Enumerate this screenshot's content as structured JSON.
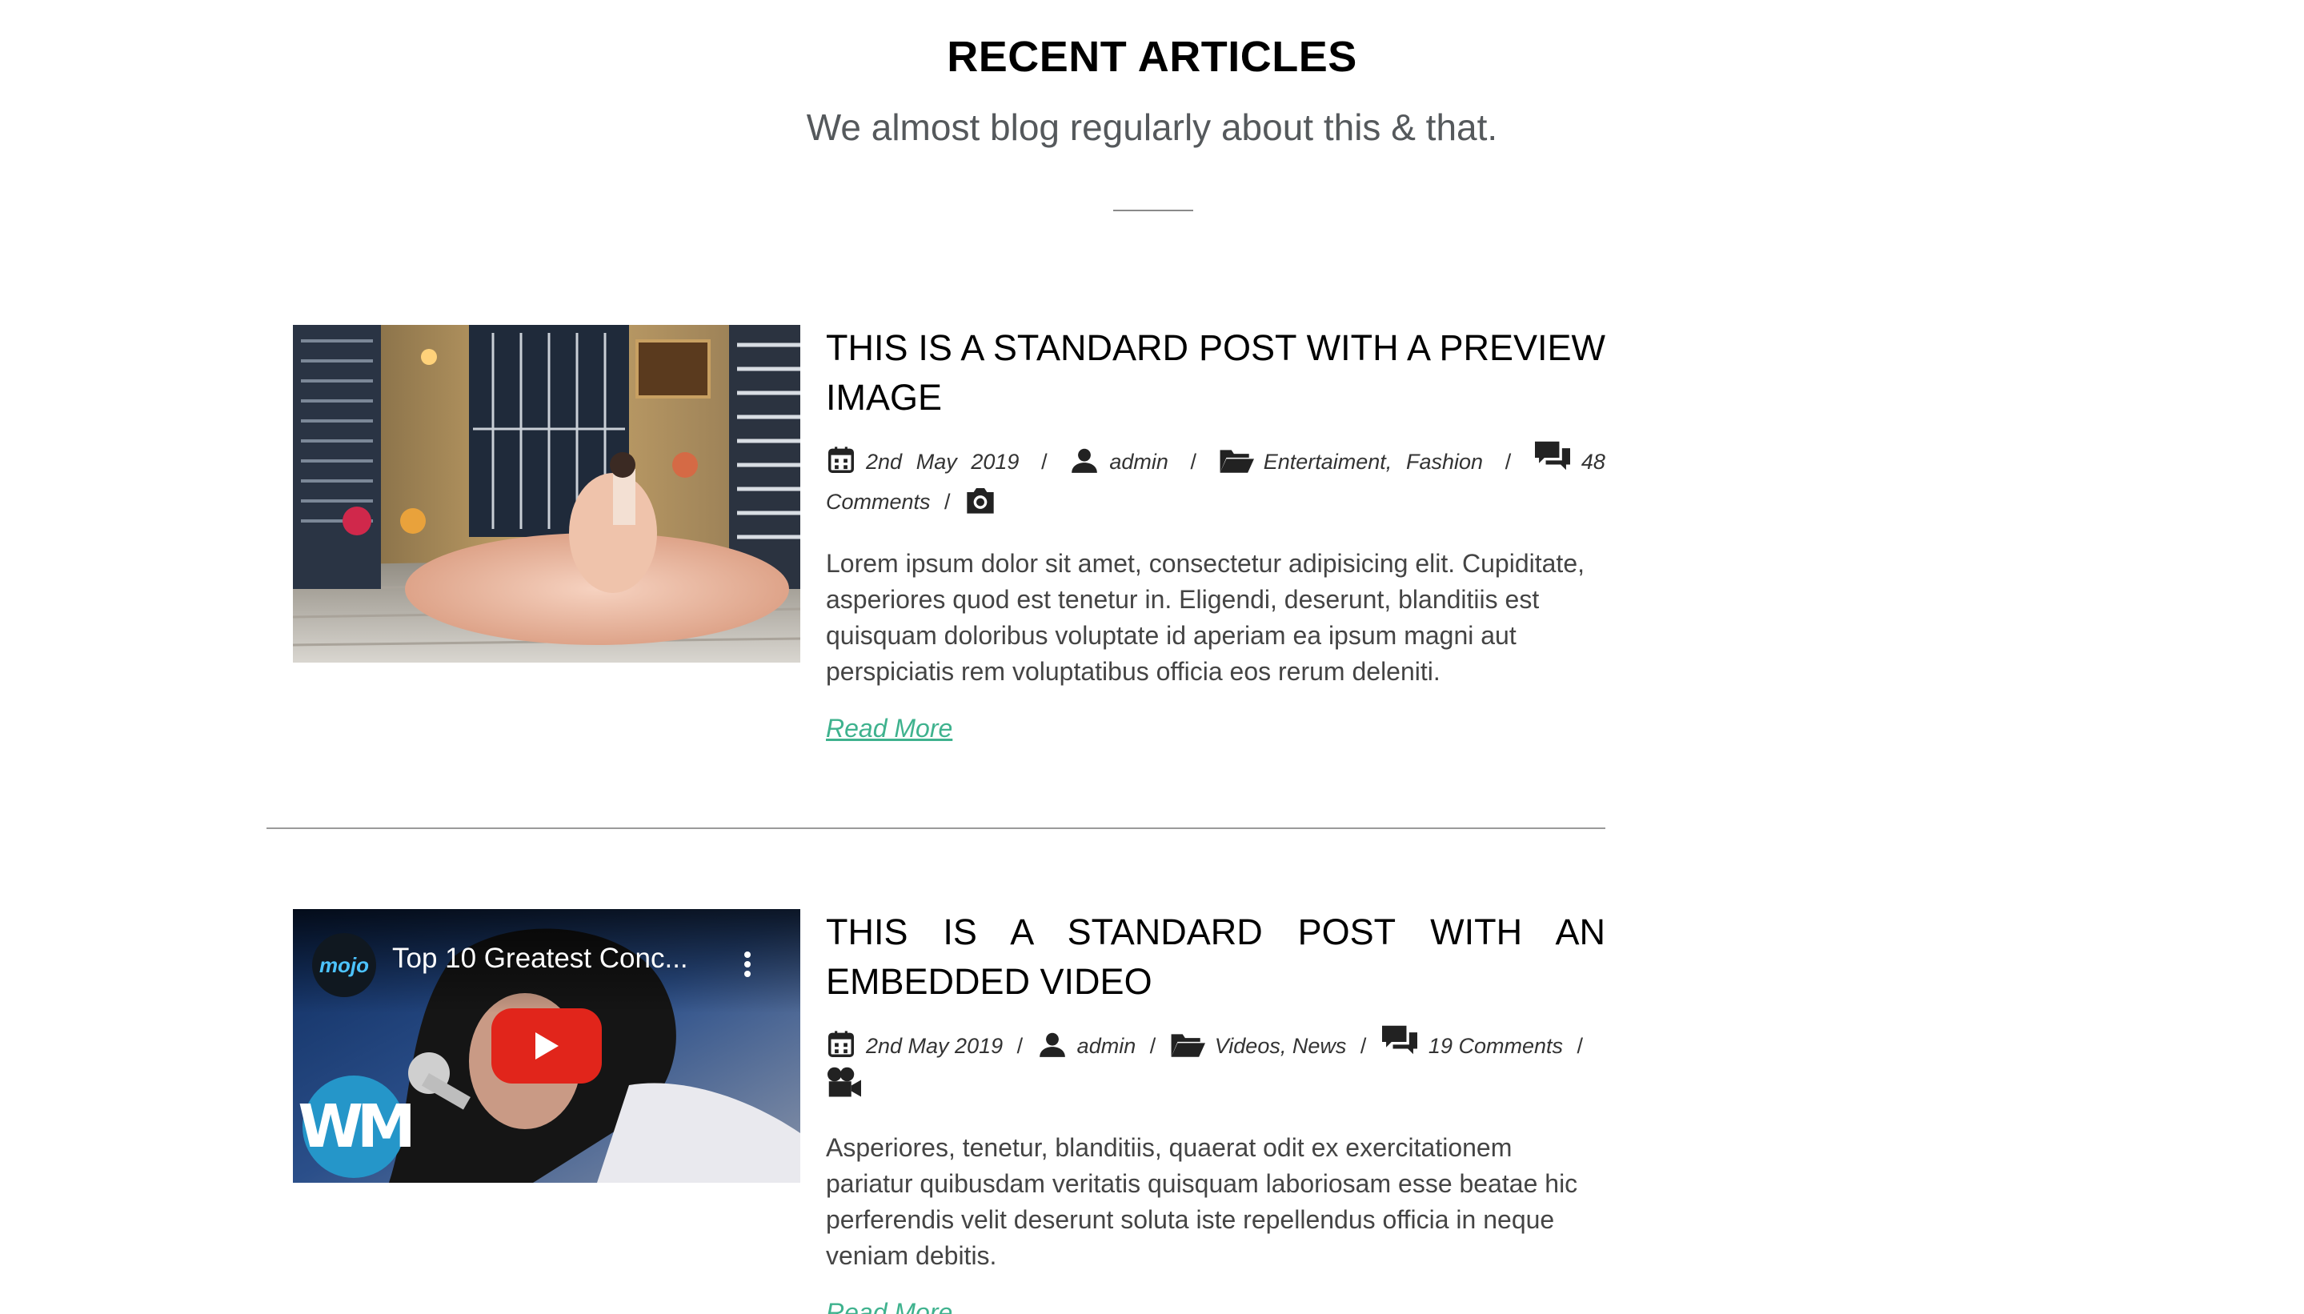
{
  "header": {
    "title": "RECENT ARTICLES",
    "subtitle": "We almost blog regularly about this & that."
  },
  "posts": [
    {
      "title": "THIS IS A STANDARD POST WITH A PREVIEW IMAGE",
      "date": "2nd May 2019",
      "author": "admin",
      "categories": [
        "Entertaiment",
        "Fashion"
      ],
      "comments": "48 Comments",
      "format_icon": "camera-icon",
      "excerpt": "Lorem ipsum dolor sit amet, consectetur adipisicing elit. Cupiditate, asperiores quod est tenetur in. Eligendi, deserunt, blanditiis est quisquam doloribus voluptate id aperiam ea ipsum magni aut perspiciatis rem voluptatibus officia eos rerum deleniti.",
      "read_more": "Read More"
    },
    {
      "title": "THIS IS A STANDARD POST WITH AN EMBEDDED VIDEO",
      "date": "2nd May 2019",
      "author": "admin",
      "categories": [
        "Videos",
        "News"
      ],
      "comments": "19 Comments",
      "format_icon": "video-camera-icon",
      "excerpt": "Asperiores, tenetur, blanditiis, quaerat odit ex exercitationem pariatur quibusdam veritatis quisquam laboriosam esse beatae hic perferendis velit deserunt soluta iste repellendus officia in neque veniam debitis.",
      "read_more": "Read More",
      "video": {
        "title": "Top 10 Greatest Conc...",
        "channel": "mojo",
        "logo": "WM"
      }
    }
  ],
  "colors": {
    "link": "#3fb28e",
    "title": "#000000",
    "text": "#444444",
    "play_button": "#e1251b"
  }
}
